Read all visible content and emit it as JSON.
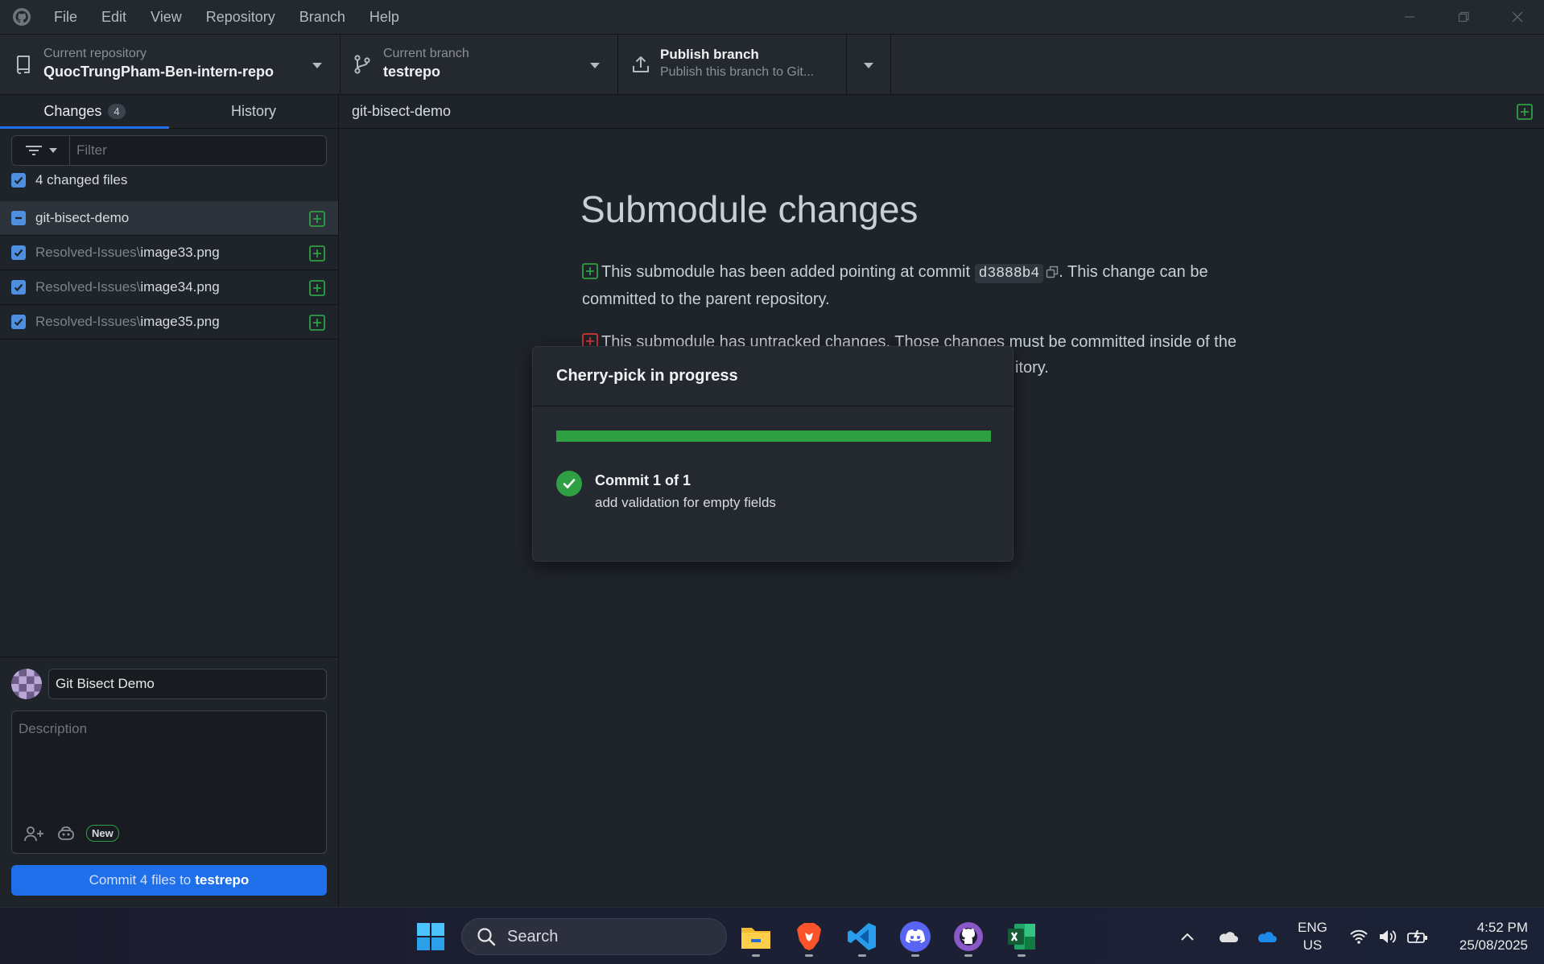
{
  "menu": [
    "File",
    "Edit",
    "View",
    "Repository",
    "Branch",
    "Help"
  ],
  "toolbar": {
    "repo_label": "Current repository",
    "repo_value": "QuocTrungPham-Ben-intern-repo",
    "branch_label": "Current branch",
    "branch_value": "testrepo",
    "publish_title": "Publish branch",
    "publish_sub": "Publish this branch to Git..."
  },
  "sidebar": {
    "tabs": [
      {
        "label": "Changes",
        "badge": "4"
      },
      {
        "label": "History"
      }
    ],
    "filter_placeholder": "Filter",
    "changed_files_label": "4 changed files",
    "files": [
      {
        "dir": "",
        "name": "git-bisect-demo"
      },
      {
        "dir": "Resolved-Issues\\",
        "name": "image33.png"
      },
      {
        "dir": "Resolved-Issues\\",
        "name": "image34.png"
      },
      {
        "dir": "Resolved-Issues\\",
        "name": "image35.png"
      }
    ],
    "commit": {
      "summary_value": "Git Bisect Demo",
      "description_placeholder": "Description",
      "new_badge": "New",
      "button_prefix": "Commit 4 files to",
      "button_branch": "testrepo"
    }
  },
  "main": {
    "path": "git-bisect-demo",
    "title": "Submodule changes",
    "line1_pre": "This submodule has been added pointing at commit",
    "line1_commit": "d3888b4",
    "line1_post": ". This change can be",
    "line1_cont": "committed to the parent repository.",
    "line2a": "This submodule has untracked changes. Those changes must be committed inside of the",
    "line2b": "itory."
  },
  "modal": {
    "title": "Cherry-pick in progress",
    "progress": 1.0,
    "step_title": "Commit 1 of 1",
    "step_desc": "add validation for empty fields"
  },
  "taskbar": {
    "search_label": "Search",
    "lang_top": "ENG",
    "lang_bottom": "US",
    "time": "4:52 PM",
    "date": "25/08/2025"
  },
  "colors": {
    "accent_blue": "#1f6feb",
    "success_green": "#2ea043",
    "danger_red": "#da3633"
  }
}
